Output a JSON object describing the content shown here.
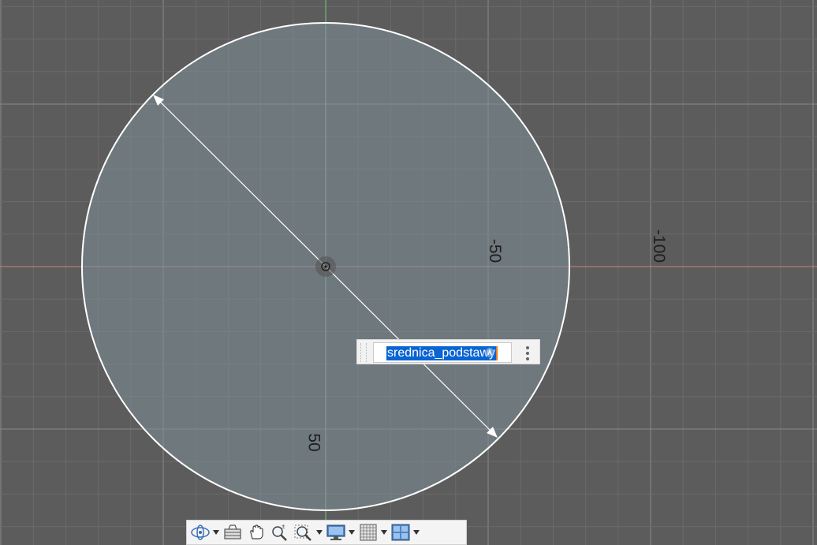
{
  "viewport": {
    "axis_labels": [
      "-50",
      "-100",
      "50"
    ],
    "colors": {
      "background": "#5c5c5c",
      "grid": "#7a7a7a",
      "x_axis": "#d08080",
      "y_axis": "#7fc27f",
      "sketch_fill": "#6f7f88",
      "sketch_line": "#ffffff"
    }
  },
  "dimension_input": {
    "value": "srednica_podstawy",
    "fx_icon": "fx-icon",
    "menu_icon": "vertical-dots-icon"
  },
  "navigation_toolbar": {
    "items": [
      {
        "name": "orbit-icon",
        "has_dropdown": true
      },
      {
        "name": "look-at-icon",
        "has_dropdown": false
      },
      {
        "name": "pan-hand-icon",
        "has_dropdown": false
      },
      {
        "name": "zoom-icon",
        "has_dropdown": false
      },
      {
        "name": "zoom-window-icon",
        "has_dropdown": true
      },
      {
        "name": "display-settings-icon",
        "has_dropdown": true
      },
      {
        "name": "grid-snaps-icon",
        "has_dropdown": true
      },
      {
        "name": "viewports-icon",
        "has_dropdown": true
      }
    ]
  }
}
